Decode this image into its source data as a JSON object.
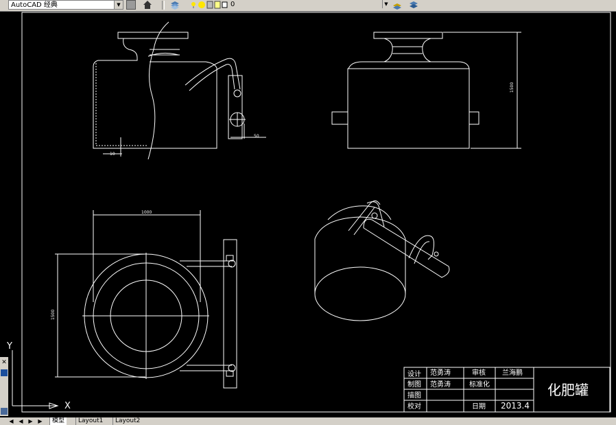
{
  "toolbar": {
    "workspace": "AutoCAD 经典",
    "layer": "0"
  },
  "ucs": {
    "y": "Y",
    "x": "X"
  },
  "dimensions": {
    "d10": "10",
    "d50": "50",
    "d1500_right": "1500",
    "d1000": "1000",
    "d1500_left": "1500"
  },
  "title_block": {
    "design_label": "设计",
    "design_name": "范勇涛",
    "review_label": "审核",
    "review_name": "兰海鹏",
    "draw_label": "制图",
    "draw_name": "范勇涛",
    "std_label": "标准化",
    "trace_label": "描图",
    "check_label": "校对",
    "date_label": "日期",
    "date_value": "2013.4",
    "drawing_title": "化肥罐"
  },
  "tabs": [
    {
      "label": "模型"
    },
    {
      "label": "Layout1"
    },
    {
      "label": "Layout2"
    }
  ],
  "colors": {
    "background": "#000000",
    "lines": "#ffffff",
    "ui": "#d4d0c8"
  }
}
